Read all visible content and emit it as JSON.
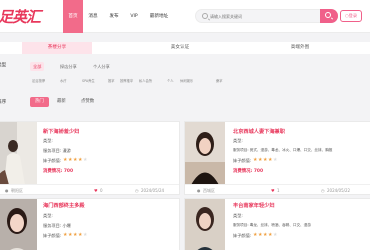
{
  "header": {
    "logo": "足英汇",
    "nav": [
      "首页",
      "消息",
      "发布",
      "VIP",
      "最新地址"
    ],
    "search_placeholder": "请输入搜索关键词",
    "login_label": "登录"
  },
  "categories": [
    "茶楼分享",
    "美女认证",
    "高端外围"
  ],
  "filters": {
    "type_label": "类型",
    "type_options": [
      "全部",
      "探店分享",
      "个人分享"
    ],
    "tags": [
      "足浴按摩",
      "水疗",
      "SPA养生",
      "推拿",
      "按摩推拿",
      "私人会所",
      "个人",
      "休闲娱乐",
      "桑拿"
    ],
    "sort_label": "排序",
    "sort_options": [
      "热门",
      "最新",
      "点赞数"
    ]
  },
  "cards": [
    {
      "title": "新下海娇羞少妇",
      "type": "类型:",
      "service": "服务项目: 漫游",
      "quality_label": "妹子颜值:",
      "price": "消费情况: 700",
      "location": "朝阳区",
      "likes": "0",
      "date": "2024/05/24",
      "rating": 4
    },
    {
      "title": "北京西城人妻下海兼职",
      "type": "类型:",
      "service": "服务项目: 莞式、漫游、毒龙、冰火、口爆、口交、丝袜、胸推",
      "quality_label": "妹子颜值:",
      "price": "消费情况: 700",
      "location": "西城区",
      "likes": "1",
      "date": "2024/05/22",
      "rating": 4
    },
    {
      "title": "海门西部终主多殿",
      "type": "类型:",
      "service": "服务项目: 小爆",
      "quality_label": "妹子颜值:",
      "price": "",
      "location": "",
      "likes": "",
      "date": "",
      "rating": 4
    },
    {
      "title": "丰台南家年轻少妇",
      "type": "类型:",
      "service": "服务项目: 毒龙、丝袜、喷酒、吞精、口交、漫游",
      "quality_label": "妹子颜值:",
      "price": "",
      "location": "",
      "likes": "",
      "date": "",
      "rating": 4
    }
  ],
  "colors": {
    "accent": "#f26b8a",
    "brand": "#e8385c",
    "star": "#f0a040"
  }
}
